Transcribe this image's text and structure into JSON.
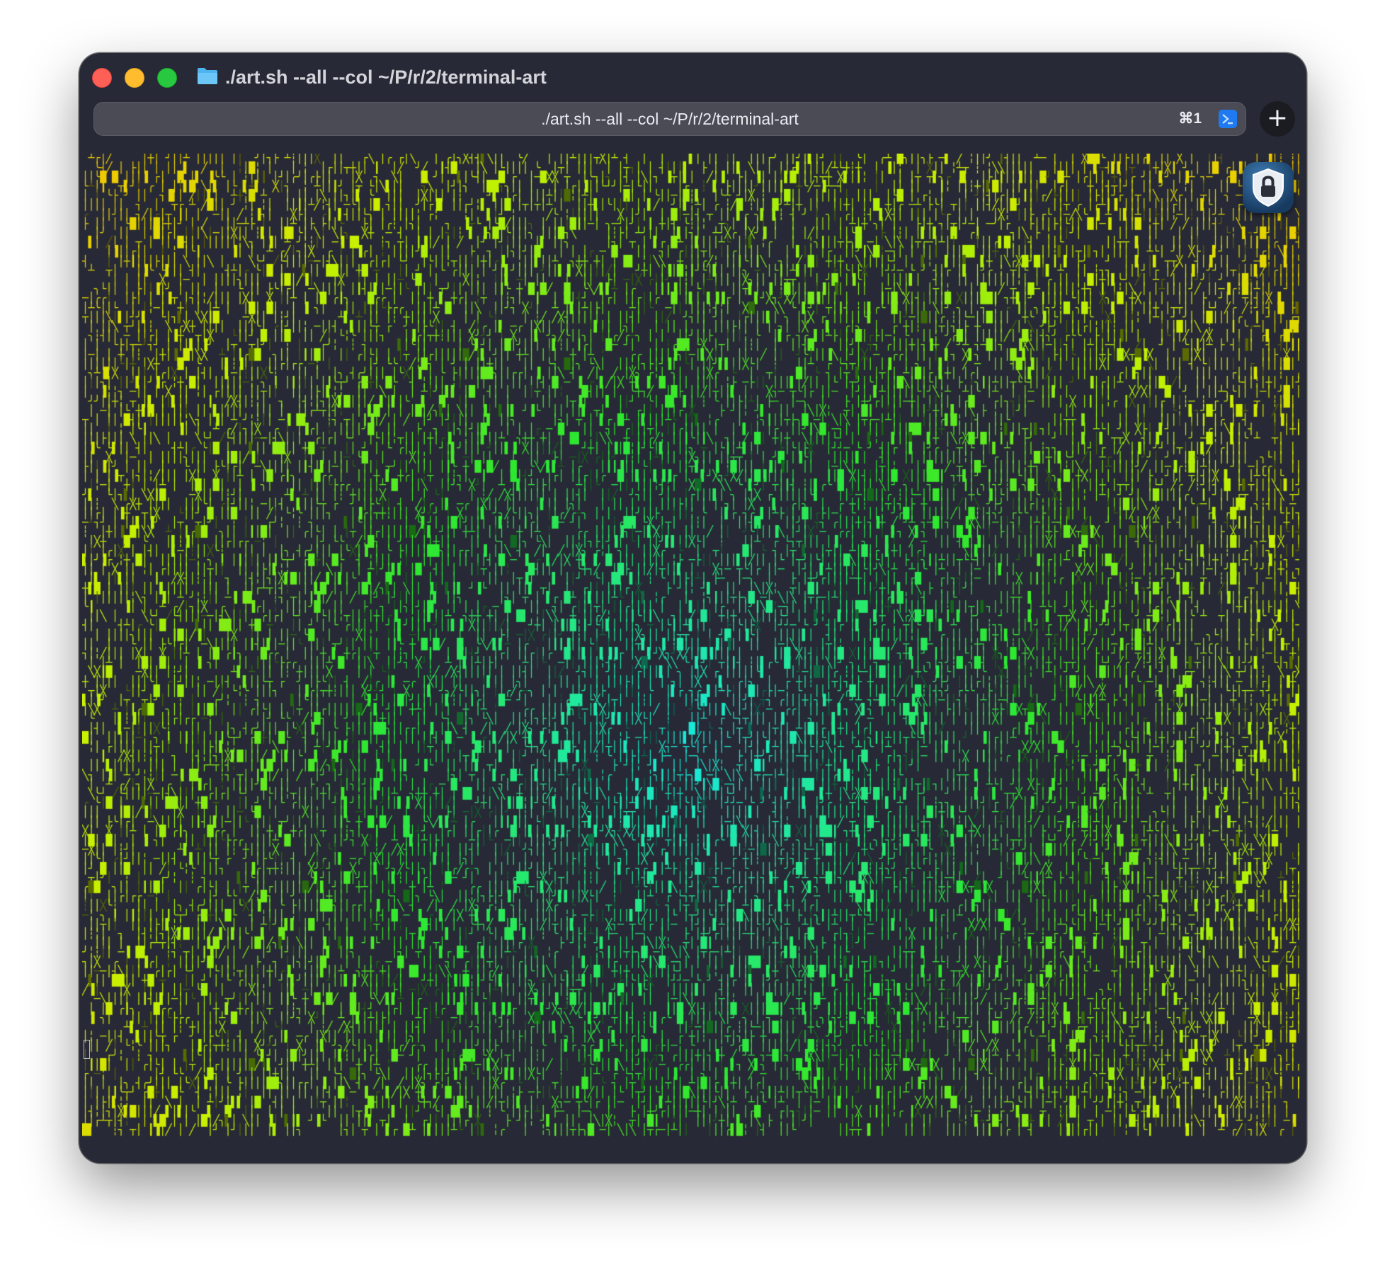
{
  "window": {
    "title": "./art.sh --all --col ~/P/r/2/terminal-art",
    "traffic_lights": [
      "close",
      "minimize",
      "zoom"
    ],
    "title_icon": "folder-icon"
  },
  "tab": {
    "title": "./art.sh --all --col ~/P/r/2/terminal-art",
    "shortcut": "⌘1",
    "badge_icon": "app-badge-icon",
    "new_tab_label": "+"
  },
  "terminal": {
    "content": "ascii-art pattern of box-drawing glyphs",
    "background": "#272a36",
    "palette": {
      "corner": "#f5c400",
      "edge_yellow": "#c8f000",
      "green": "#2ee82e",
      "center": "#18e8e0"
    },
    "glyphs": [
      "│",
      "─",
      "┌",
      "┐",
      "└",
      "┘",
      "├",
      "┤",
      "┬",
      "┴",
      "┼",
      "╳",
      "╱",
      "╲",
      "┃",
      "╎",
      "┆",
      "█",
      "▌",
      "▐",
      "╭",
      "╮",
      "╰",
      "╯"
    ]
  },
  "overlay": {
    "icon": "lock-shield-icon"
  }
}
